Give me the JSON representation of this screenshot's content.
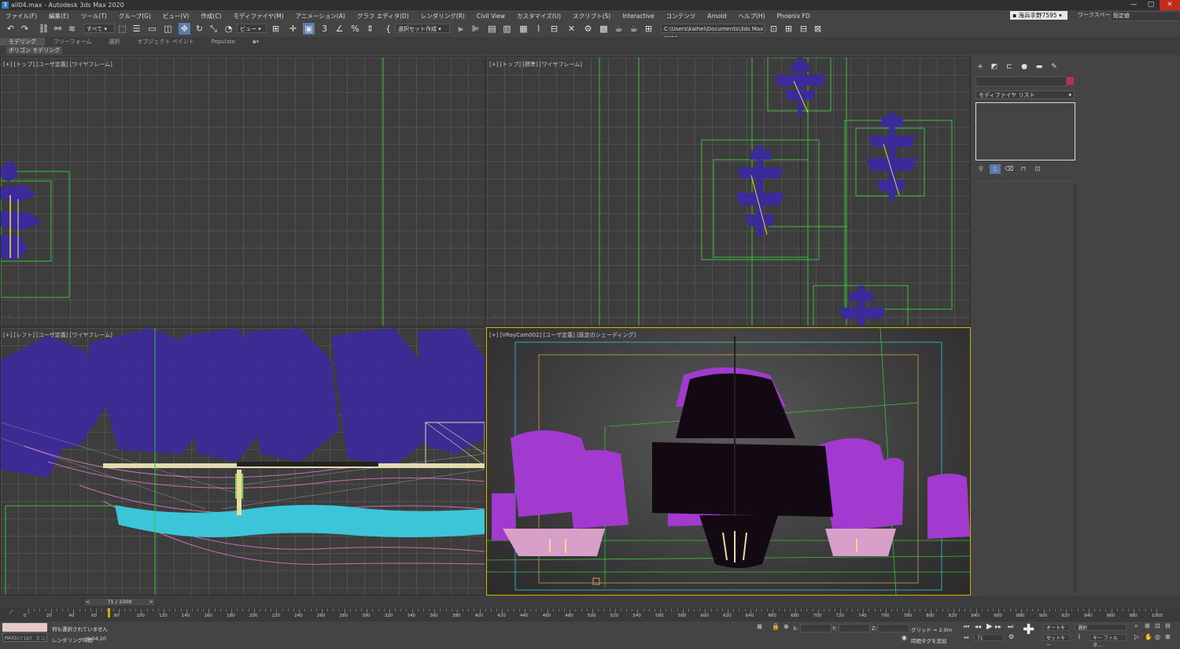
{
  "window": {
    "title": "all04.max - Autodesk 3ds Max 2020",
    "app_icon": "3",
    "min": "—",
    "max": "▢",
    "close": "✕"
  },
  "menu": [
    "ファイル(F)",
    "編集(E)",
    "ツール(T)",
    "グループ(G)",
    "ビュー(V)",
    "作成(C)",
    "モディファイヤ(M)",
    "アニメーション(A)",
    "グラフ エディタ(D)",
    "レンダリング(R)",
    "Civil View",
    "カスタマイズ(U)",
    "スクリプト(S)",
    "Interactive",
    "コンテンツ",
    "Arnold",
    "ヘルプ(H)",
    "Phoenix FD"
  ],
  "user": {
    "name": "海兵手野7595",
    "workspace_label": "ワークスペース:",
    "workspace_value": "既定値"
  },
  "toolbar": {
    "selection_filter": "すべて",
    "ref_coord": "ビュー",
    "named_selection": "選択セット作成",
    "project_path": "C:\\Users\\kaihei\\Documents\\3ds Max 2020"
  },
  "ribbon": {
    "tabs": [
      "モデリング",
      "フリーフォーム",
      "選択",
      "オブジェクト ペイント",
      "Populate"
    ],
    "active": 0,
    "sub": "ポリゴン モデリング"
  },
  "viewports": {
    "top_left": "[+] [トップ] [ユーザ定義] [ワイヤフレーム]",
    "top_right": "[+] [トップ] [標準] [ワイヤフレーム]",
    "bottom_left": "[+] [レフト] [ユーザ定義] [ワイヤフレーム]",
    "bottom_right": "[+] [VRayCam002] [ユーザ定義] [既定のシェーディング]"
  },
  "command_panel": {
    "modifier_list": "モディファイヤ リスト",
    "accent_color": "#c0276e"
  },
  "timeline": {
    "slider": "71 / 1000",
    "prev": "<",
    "next": ">",
    "ticks": [
      0,
      20,
      40,
      60,
      80,
      100,
      120,
      140,
      160,
      180,
      200,
      220,
      240,
      260,
      280,
      300,
      320,
      340,
      360,
      380,
      400,
      420,
      440,
      460,
      480,
      500,
      520,
      540,
      560,
      580,
      600,
      620,
      640,
      660,
      680,
      700,
      720,
      740,
      760,
      780,
      800,
      820,
      840,
      860,
      880,
      900,
      920,
      940,
      960,
      980,
      1000
    ]
  },
  "status": {
    "maxscript": "MAXScript ミニ",
    "selection": "何も選択されていません",
    "render_time_label": "レンダリング時間",
    "render_time": "0:04:20",
    "x_label": "X:",
    "y_label": "Y:",
    "z_label": "Z:",
    "grid": "グリッド = 2.0m",
    "add_time_tag": "時間タグを追加",
    "auto_key": "オートキー",
    "set_key": "セットキー",
    "selection_set": "選択",
    "key_filter": "キー フィルタ...",
    "frame": "71"
  },
  "colors": {
    "bg": "#444444",
    "grid": "#505050",
    "wire_green": "#3bbf3b",
    "sail_purple": "#3b2a9a",
    "ship_magenta": "#a23ad0",
    "hull_cyan": "#3cc4d8",
    "active_viewport": "#c8b400"
  }
}
